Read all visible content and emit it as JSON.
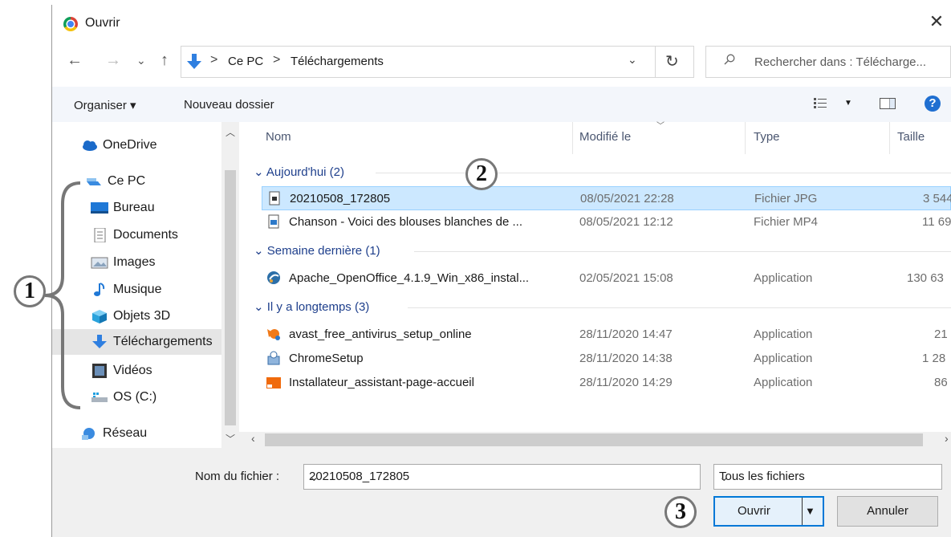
{
  "window": {
    "title": "Ouvrir",
    "close": "✕"
  },
  "nav": {
    "back": "←",
    "forward": "→",
    "recent": "⌄",
    "up": "↑"
  },
  "address": {
    "crumbs": [
      "Ce PC",
      "Téléchargements"
    ],
    "separator": ">",
    "dropdown": "⌄",
    "refresh": "↻"
  },
  "search": {
    "placeholder": "Rechercher dans : Télécharge..."
  },
  "toolbar": {
    "organize": "Organiser ▾",
    "new_folder": "Nouveau dossier",
    "help": "?"
  },
  "sidebar": {
    "items": [
      {
        "label": "OneDrive",
        "icon": "cloud-icon"
      },
      {
        "label": "Ce PC",
        "icon": "computer-icon"
      },
      {
        "label": "Bureau",
        "icon": "desktop-icon"
      },
      {
        "label": "Documents",
        "icon": "document-icon"
      },
      {
        "label": "Images",
        "icon": "images-icon"
      },
      {
        "label": "Musique",
        "icon": "music-icon"
      },
      {
        "label": "Objets 3D",
        "icon": "cube-icon"
      },
      {
        "label": "Téléchargements",
        "icon": "download-icon"
      },
      {
        "label": "Vidéos",
        "icon": "video-icon"
      },
      {
        "label": "OS (C:)",
        "icon": "drive-icon"
      },
      {
        "label": "Réseau",
        "icon": "network-icon"
      }
    ]
  },
  "columns": {
    "name": "Nom",
    "modified": "Modifié le",
    "type": "Type",
    "size": "Taille"
  },
  "groups": [
    {
      "label": "Aujourd'hui (2)"
    },
    {
      "label": "Semaine dernière (1)"
    },
    {
      "label": "Il y a longtemps (3)"
    }
  ],
  "files": [
    {
      "name": "20210508_172805",
      "modified": "08/05/2021 22:28",
      "type": "Fichier JPG",
      "size": "3 544",
      "icon": "image-file-icon",
      "selected": true
    },
    {
      "name": "Chanson - Voici des blouses blanches de ...",
      "modified": "08/05/2021 12:12",
      "type": "Fichier MP4",
      "size": "11 69",
      "icon": "video-file-icon"
    },
    {
      "name": "Apache_OpenOffice_4.1.9_Win_x86_instal...",
      "modified": "02/05/2021 15:08",
      "type": "Application",
      "size": "130 63",
      "icon": "openoffice-icon"
    },
    {
      "name": "avast_free_antivirus_setup_online",
      "modified": "28/11/2020 14:47",
      "type": "Application",
      "size": "21",
      "icon": "avast-icon"
    },
    {
      "name": "ChromeSetup",
      "modified": "28/11/2020 14:38",
      "type": "Application",
      "size": "1 28",
      "icon": "installer-icon"
    },
    {
      "name": "Installateur_assistant-page-accueil",
      "modified": "28/11/2020 14:29",
      "type": "Application",
      "size": "86",
      "icon": "orange-installer-icon"
    }
  ],
  "footer": {
    "filename_label": "Nom du fichier :",
    "filename_value": "20210508_172805",
    "filter_value": "Tous les fichiers",
    "open_label": "Ouvrir",
    "cancel_label": "Annuler"
  },
  "annotations": [
    "1",
    "2",
    "3"
  ]
}
